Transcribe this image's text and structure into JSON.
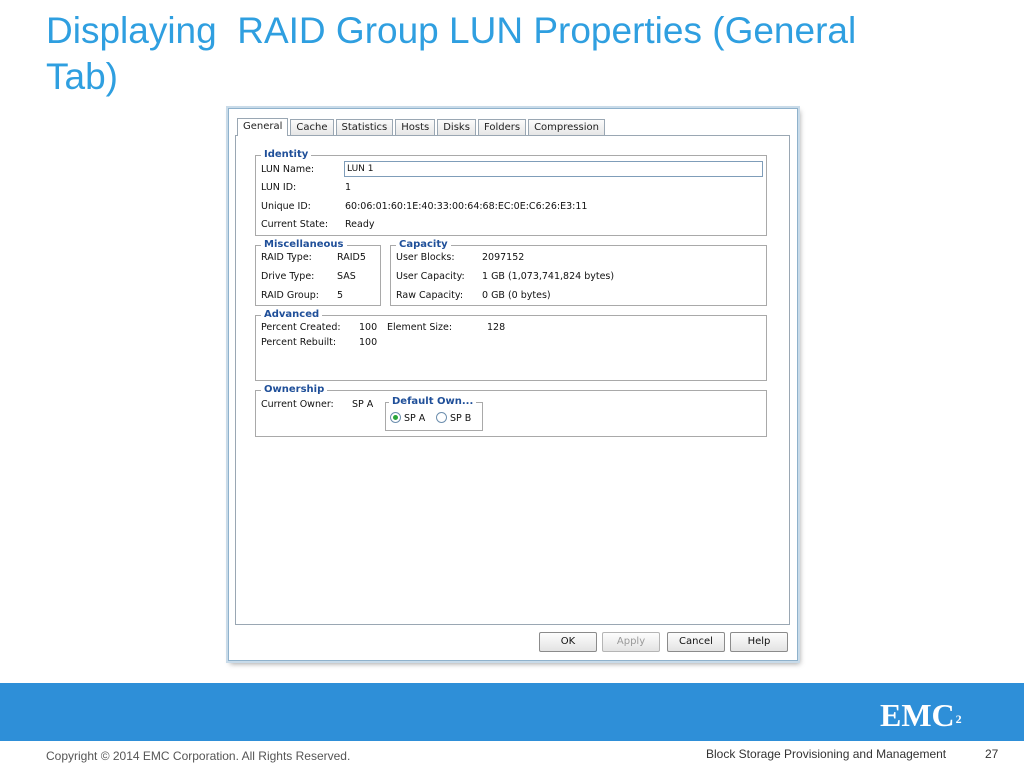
{
  "slide": {
    "title_line1": "Displaying  RAID Group LUN Properties (General",
    "title_line2": "Tab)"
  },
  "dialog": {
    "tabs": [
      {
        "label": "General",
        "active": true
      },
      {
        "label": "Cache"
      },
      {
        "label": "Statistics"
      },
      {
        "label": "Hosts"
      },
      {
        "label": "Disks"
      },
      {
        "label": "Folders"
      },
      {
        "label": "Compression"
      }
    ],
    "identity": {
      "legend": "Identity",
      "lun_name_label": "LUN Name:",
      "lun_name_value": "LUN 1",
      "lun_id_label": "LUN ID:",
      "lun_id_value": "1",
      "unique_id_label": "Unique ID:",
      "unique_id_value": "60:06:01:60:1E:40:33:00:64:68:EC:0E:C6:26:E3:11",
      "state_label": "Current State:",
      "state_value": "Ready"
    },
    "misc": {
      "legend": "Miscellaneous",
      "raid_type_label": "RAID Type:",
      "raid_type_value": "RAID5",
      "drive_type_label": "Drive Type:",
      "drive_type_value": "SAS",
      "raid_group_label": "RAID Group:",
      "raid_group_value": "5"
    },
    "capacity": {
      "legend": "Capacity",
      "user_blocks_label": "User Blocks:",
      "user_blocks_value": "2097152",
      "user_capacity_label": "User Capacity:",
      "user_capacity_value": "1 GB (1,073,741,824 bytes)",
      "raw_capacity_label": "Raw Capacity:",
      "raw_capacity_value": "0 GB (0 bytes)"
    },
    "advanced": {
      "legend": "Advanced",
      "percent_created_label": "Percent Created:",
      "percent_created_value": "100",
      "element_size_label": "Element Size:",
      "element_size_value": "128",
      "percent_rebuilt_label": "Percent Rebuilt:",
      "percent_rebuilt_value": "100"
    },
    "ownership": {
      "legend": "Ownership",
      "current_owner_label": "Current Owner:",
      "current_owner_value": "SP A",
      "default_owner_legend": "Default Own...",
      "options": [
        {
          "label": "SP A",
          "selected": true
        },
        {
          "label": "SP B",
          "selected": false
        }
      ]
    },
    "buttons": {
      "ok": "OK",
      "apply": "Apply",
      "cancel": "Cancel",
      "help": "Help"
    }
  },
  "footer": {
    "logo": "EMC",
    "logo_sup": "2",
    "copyright": "Copyright © 2014 EMC Corporation. All Rights Reserved.",
    "course": "Block Storage Provisioning and Management",
    "page": "27"
  },
  "colors": {
    "title": "#2f9fe0",
    "footer_band": "#2e8fd8",
    "legend_text": "#1f4f99",
    "radio_selected": "#2aa53a"
  }
}
